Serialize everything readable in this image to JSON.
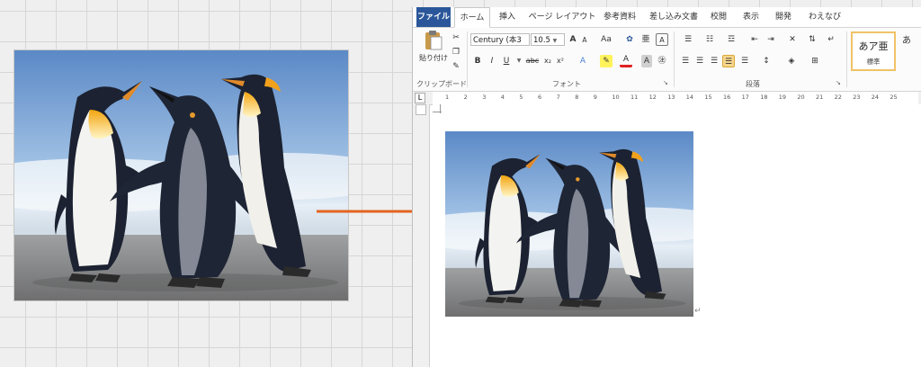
{
  "arrow_color": "#e3641f",
  "word": {
    "accent": "#2b579a",
    "tabs": [
      {
        "label": "ファイル"
      },
      {
        "label": "ホーム"
      },
      {
        "label": "挿入"
      },
      {
        "label": "ページ レイアウト"
      },
      {
        "label": "参考資料"
      },
      {
        "label": "差し込み文書"
      },
      {
        "label": "校閲"
      },
      {
        "label": "表示"
      },
      {
        "label": "開発"
      },
      {
        "label": "わえなび"
      }
    ],
    "clipboard": {
      "paste_label": "貼り付け",
      "group_label": "クリップボード"
    },
    "font": {
      "font_name": "Century (本3",
      "font_size": "10.5",
      "grow": "A",
      "shrink": "A",
      "case": "Aa",
      "bold": "B",
      "italic": "I",
      "underline": "U",
      "strike": "abc",
      "subscript": "x₂",
      "superscript": "x²",
      "font_color": "A",
      "group_label": "フォント"
    },
    "paragraph": {
      "group_label": "段落"
    },
    "styles": {
      "preview": "あア亜",
      "name": "標準"
    },
    "ruler_numbers": [
      "1",
      "2",
      "3",
      "4",
      "5",
      "6",
      "7",
      "8",
      "9",
      "10",
      "11",
      "12",
      "13",
      "14",
      "15",
      "16",
      "17",
      "18",
      "19",
      "20",
      "21",
      "22",
      "23",
      "24",
      "25"
    ],
    "paragraph_mark": "↵"
  }
}
